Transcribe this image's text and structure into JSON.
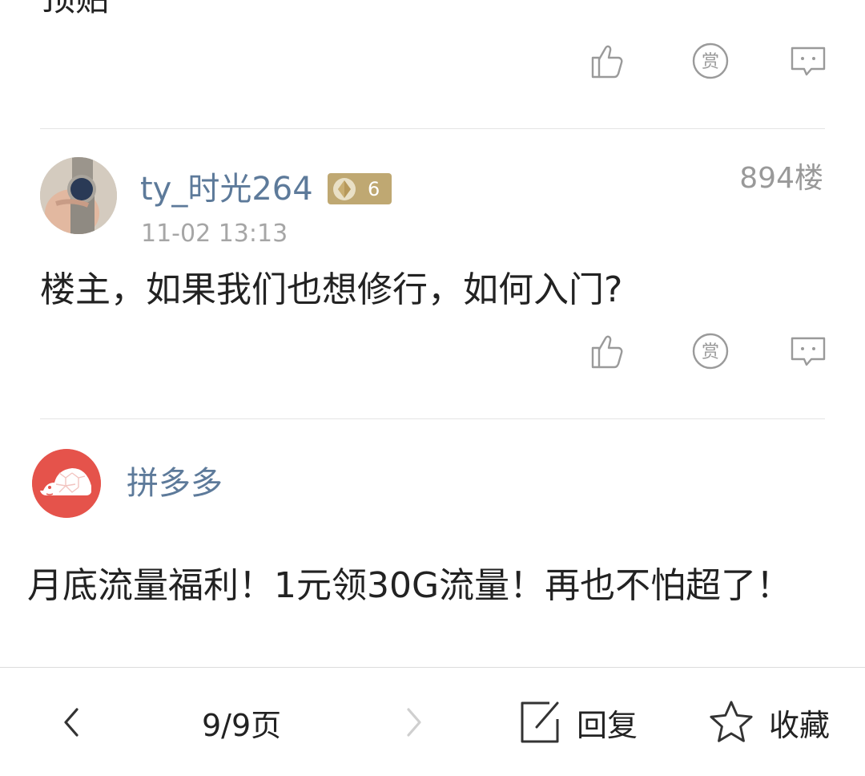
{
  "previous_post": {
    "cut_text": "顶贴"
  },
  "reply_894": {
    "username": "ty_时光264",
    "level": "6",
    "time": "11-02 13:13",
    "floor": "894楼",
    "content": "楼主，如果我们也想修行，如何入门?"
  },
  "ad": {
    "name": "拼多多",
    "content": "月底流量福利！1元领30G流量！再也不怕超了！"
  },
  "actions": {
    "like_icon": "thumbs-up-icon",
    "reward_icon": "reward-icon",
    "reward_glyph": "赏",
    "comment_icon": "comment-icon"
  },
  "bottom_bar": {
    "page_indicator": "9/9页",
    "reply_label": "回复",
    "favorite_label": "收藏"
  },
  "colors": {
    "username": "#5d7a9a",
    "badge": "#bfa872",
    "pdd_red": "#e5534b"
  }
}
